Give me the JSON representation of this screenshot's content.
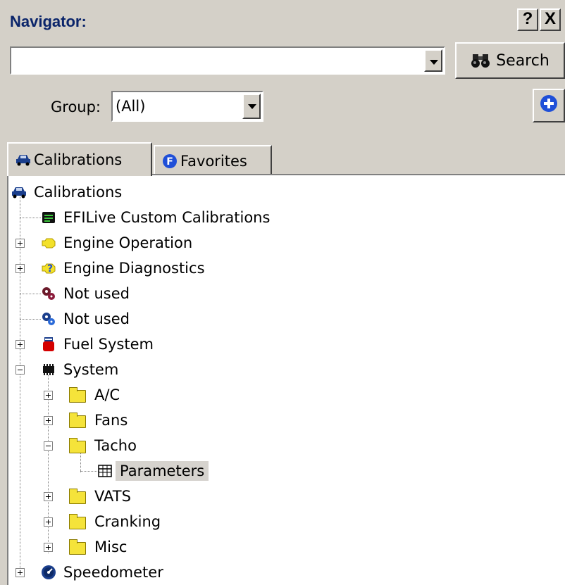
{
  "header": {
    "title": "Navigator:",
    "help_button": "?",
    "close_button": "X"
  },
  "search": {
    "value": "",
    "button_label": "Search"
  },
  "group": {
    "label": "Group:",
    "value": "(All)"
  },
  "tabs": [
    {
      "label": "Calibrations",
      "icon": "car-icon",
      "active": true
    },
    {
      "label": "Favorites",
      "icon": "favorites-f-icon",
      "active": false
    }
  ],
  "tree": {
    "root": "Calibrations",
    "items": [
      {
        "label": "EFILive Custom Calibrations",
        "icon": "custom-calibrations-icon"
      },
      {
        "label": "Engine Operation",
        "icon": "engine-icon"
      },
      {
        "label": "Engine Diagnostics",
        "icon": "diagnostics-icon"
      },
      {
        "label": "Not used",
        "icon": "gears-red-icon"
      },
      {
        "label": "Not used",
        "icon": "gears-blue-icon"
      },
      {
        "label": "Fuel System",
        "icon": "fuel-pump-icon"
      },
      {
        "label": "System",
        "icon": "chip-icon"
      },
      {
        "label": "A/C",
        "icon": "folder-icon"
      },
      {
        "label": "Fans",
        "icon": "folder-icon"
      },
      {
        "label": "Tacho",
        "icon": "folder-icon"
      },
      {
        "label": "Parameters",
        "icon": "table-icon",
        "selected": true
      },
      {
        "label": "VATS",
        "icon": "folder-icon"
      },
      {
        "label": "Cranking",
        "icon": "folder-icon"
      },
      {
        "label": "Misc",
        "icon": "folder-icon"
      },
      {
        "label": "Speedometer",
        "icon": "speedometer-icon"
      }
    ]
  },
  "colors": {
    "panel": "#d4d0c8",
    "title": "#0a246a",
    "folder": "#f5e33a",
    "selection": "#d6d3ce"
  }
}
